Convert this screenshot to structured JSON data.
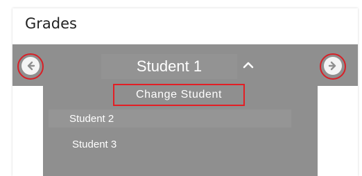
{
  "header": {
    "title": "Grades"
  },
  "student_bar": {
    "current_student": "Student 1",
    "change_button_label": "Change Student"
  },
  "student_menu": {
    "options": [
      "Student 2",
      "Student 3"
    ]
  },
  "colors": {
    "bar_bg": "#8f8f8f",
    "highlight_ring": "#d81f26",
    "nav_button_bg": "#f4f4f4"
  },
  "icons": {
    "prev": "arrow-left-circle-icon",
    "next": "arrow-right-circle-icon",
    "toggle": "chevron-up-icon"
  }
}
